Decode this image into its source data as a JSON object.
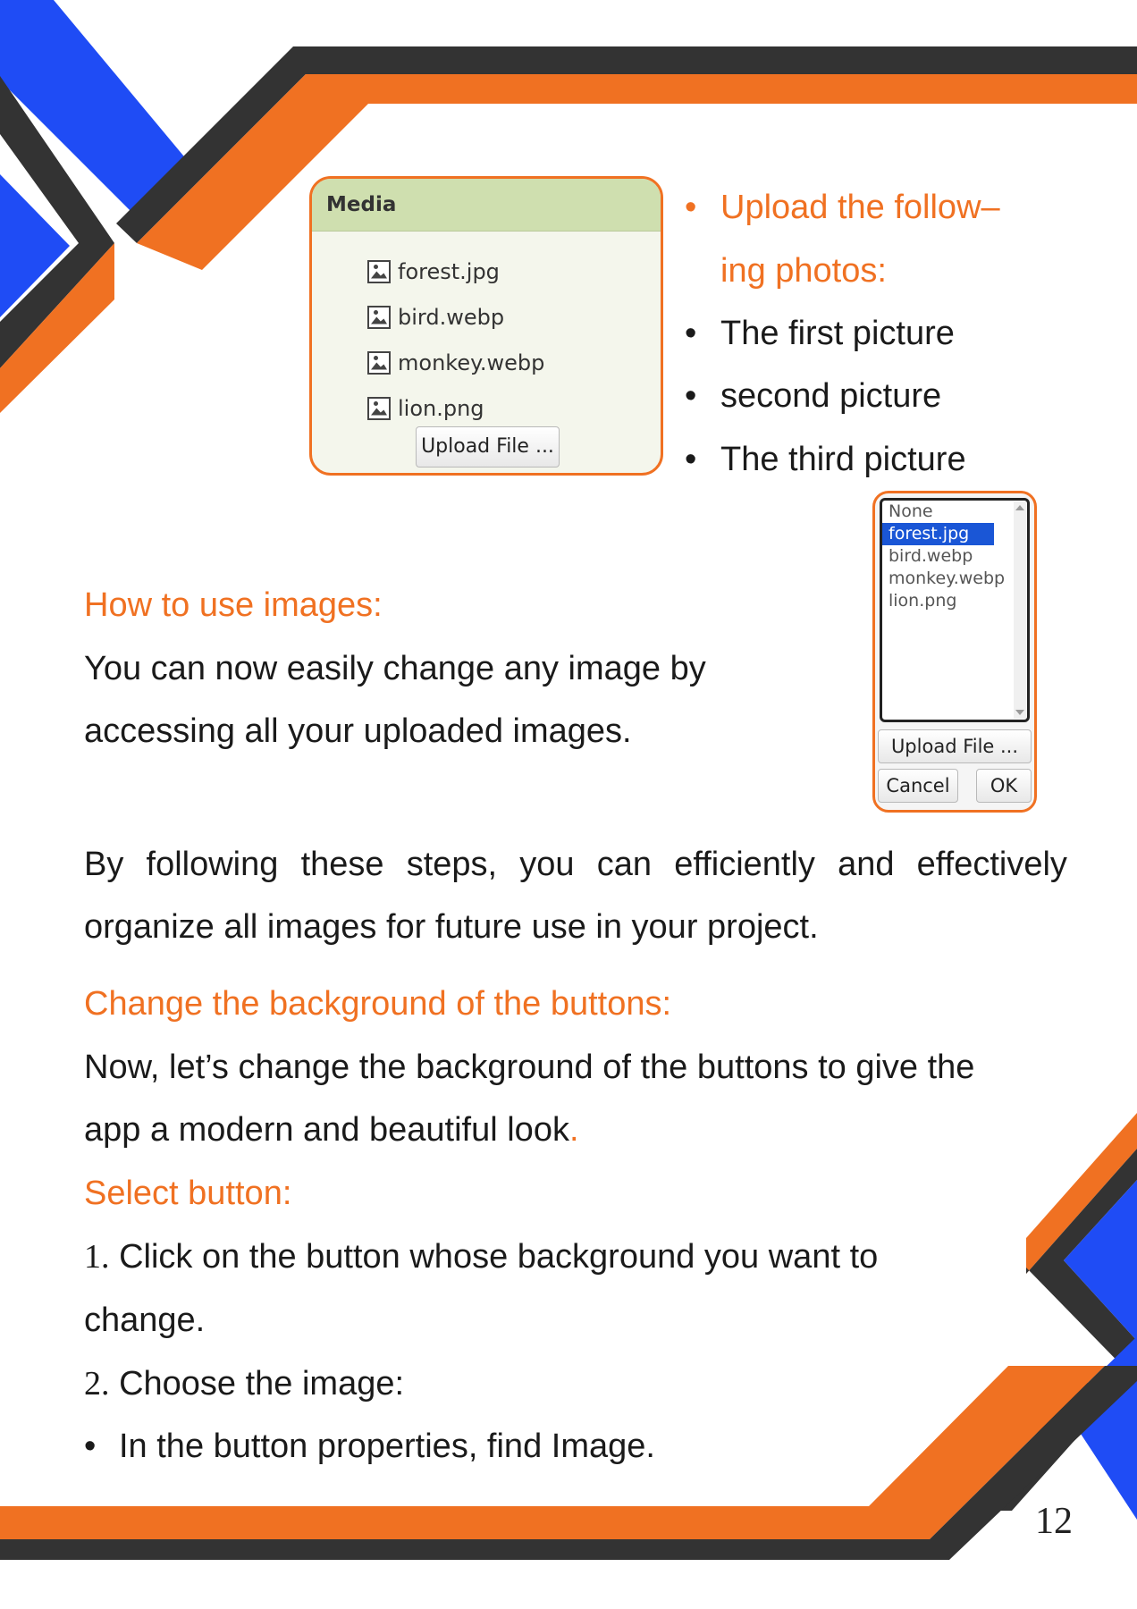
{
  "media_panel": {
    "title": "Media",
    "files": [
      "forest.jpg",
      "bird.webp",
      "monkey.webp",
      "lion.png"
    ],
    "upload_label": "Upload File ..."
  },
  "upload_list": {
    "heading_line1": "Upload the follow–",
    "heading_line2": "ing photos:",
    "items": [
      "The first picture",
      "second picture",
      "The third picture"
    ]
  },
  "picker": {
    "options": [
      "None",
      "forest.jpg",
      "bird.webp",
      "monkey.webp",
      "lion.png"
    ],
    "selected": "forest.jpg",
    "upload_label": "Upload File ...",
    "cancel_label": "Cancel",
    "ok_label": "OK"
  },
  "how_to": {
    "heading": "How to use images:",
    "line1": "You can now easily change any image by",
    "line2": "accessing all your uploaded images."
  },
  "steps_paragraph": {
    "line1_words": [
      "By",
      "following",
      "these",
      "steps,",
      "you",
      "can",
      "efficiently",
      "and",
      "effectively"
    ],
    "line2": "organize all images for future use in your project."
  },
  "change_bg": {
    "heading": "Change the background of the buttons:",
    "line1": "Now, let’s change the background of the buttons to give the",
    "line2": "app a modern and beautiful look",
    "period": "."
  },
  "select_button": {
    "heading": "Select button:",
    "step1_num": "1.",
    "step1_line1": "Click on the button whose background you want to",
    "step1_line2": "change.",
    "step2_num": "2.",
    "step2_text": "Choose the image:",
    "bullet": "In the button properties, find Image."
  },
  "page_number": "12",
  "colors": {
    "orange": "#f07122",
    "blue": "#1f4cf5",
    "dark": "#333333"
  }
}
